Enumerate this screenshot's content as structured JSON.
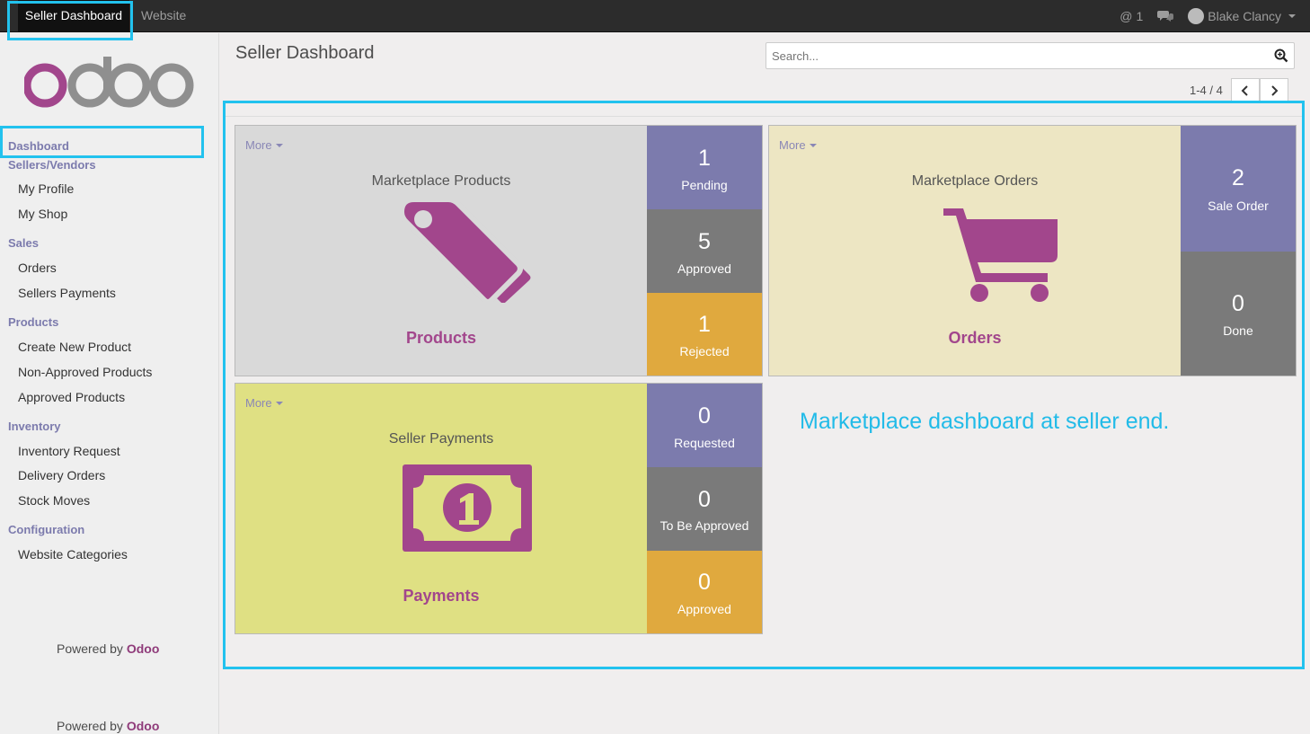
{
  "topbar": {
    "apps": [
      "Seller Dashboard",
      "Website"
    ],
    "mentions": "1",
    "user": "Blake Clancy"
  },
  "sidebar": {
    "logo_text": "odoo",
    "sections": [
      {
        "title": "Dashboard",
        "items": []
      },
      {
        "title": "Sellers/Vendors",
        "items": [
          "My Profile",
          "My Shop"
        ]
      },
      {
        "title": "Sales",
        "items": [
          "Orders",
          "Sellers Payments"
        ]
      },
      {
        "title": "Products",
        "items": [
          "Create New Product",
          "Non-Approved Products",
          "Approved Products"
        ]
      },
      {
        "title": "Inventory",
        "items": [
          "Inventory Request",
          "Delivery Orders",
          "Stock Moves"
        ]
      },
      {
        "title": "Configuration",
        "items": [
          "Website Categories"
        ]
      }
    ],
    "powered_prefix": "Powered by",
    "powered_brand": "Odoo"
  },
  "main": {
    "title": "Seller Dashboard",
    "search_placeholder": "Search...",
    "pager": "1-4 / 4",
    "more_label": "More",
    "tiles": [
      {
        "subtitle": "Marketplace Products",
        "name": "Products",
        "icon": "tags-icon",
        "stats": [
          {
            "value": "1",
            "label": "Pending"
          },
          {
            "value": "5",
            "label": "Approved"
          },
          {
            "value": "1",
            "label": "Rejected"
          }
        ]
      },
      {
        "subtitle": "Marketplace Orders",
        "name": "Orders",
        "icon": "shopping-cart-icon",
        "stats": [
          {
            "value": "2",
            "label": "Sale Order"
          },
          {
            "value": "0",
            "label": "Done"
          }
        ]
      },
      {
        "subtitle": "Seller Payments",
        "name": "Payments",
        "icon": "money-bill-icon",
        "stats": [
          {
            "value": "0",
            "label": "Requested"
          },
          {
            "value": "0",
            "label": "To Be Approved"
          },
          {
            "value": "0",
            "label": "Approved"
          }
        ]
      }
    ]
  },
  "annotation": "Marketplace dashboard at seller end.",
  "colors": {
    "tile_purple": "#7c7bad",
    "tile_grey": "#7a7a7a",
    "tile_orange": "#e0a93e",
    "products_bg": "#d9d9d9",
    "orders_bg": "#ede6c3",
    "payments_bg": "#dfe083",
    "brand": "#a2468c",
    "highlight": "#22c2ee"
  }
}
